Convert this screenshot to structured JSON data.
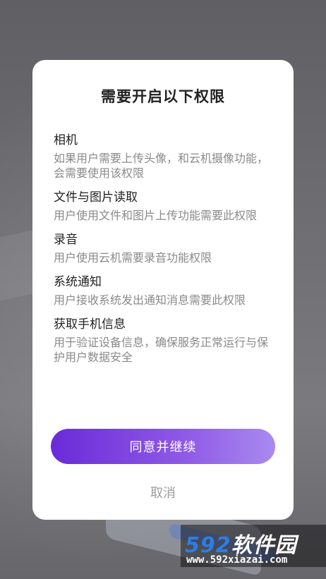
{
  "dialog": {
    "title": "需要开启以下权限",
    "permissions": [
      {
        "name": "相机",
        "description": "如果用户需要上传头像，和云机摄像功能，会需要使用该权限"
      },
      {
        "name": "文件与图片读取",
        "description": "用户使用文件和图片上传功能需要此权限"
      },
      {
        "name": "录音",
        "description": "用户使用云机需要录音功能权限"
      },
      {
        "name": "系统通知",
        "description": "用户接收系统发出通知消息需要此权限"
      },
      {
        "name": "获取手机信息",
        "description": "用于验证设备信息，确保服务正常运行与保护用户数据安全"
      }
    ],
    "agree_label": "同意并继续",
    "cancel_label": "取消"
  },
  "watermark": {
    "brand_number": "592",
    "brand_text": "软件园",
    "url": "www.592xiazai.com"
  },
  "colors": {
    "primary_gradient_start": "#6a2bd8",
    "primary_gradient_end": "#a98af0",
    "overlay": "#6b6b70"
  }
}
